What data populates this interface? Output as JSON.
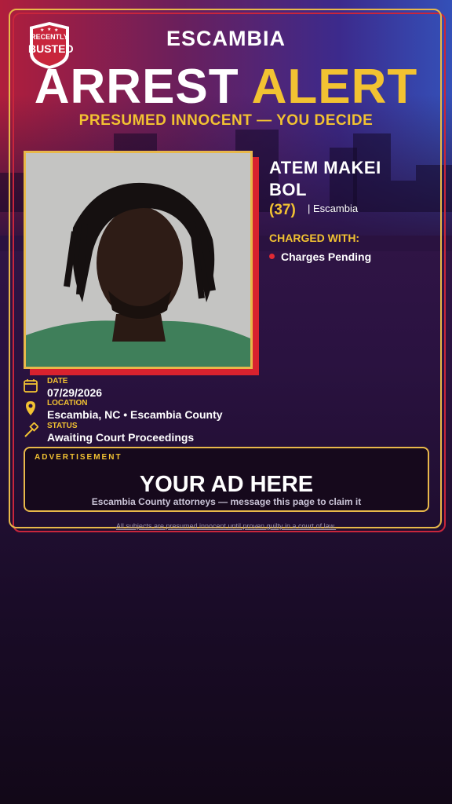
{
  "badge": {
    "line1": "RECENTLY",
    "line2": "BUSTED"
  },
  "header": {
    "county": "ESCAMBIA",
    "headline_word1": "ARREST",
    "headline_word2": "ALERT",
    "tagline": "PRESUMED INNOCENT — YOU DECIDE"
  },
  "subject": {
    "name_line1": "ATEM MAKEI",
    "name_line2": "BOL",
    "age": "(37)",
    "location_tag": "| Escambia",
    "charged_with_label": "CHARGED WITH:",
    "charges": [
      "Charges Pending"
    ]
  },
  "details": {
    "date_label": "DATE",
    "date_value": "07/29/2026",
    "location_label": "LOCATION",
    "location_value": "Escambia, NC • Escambia County",
    "status_label": "STATUS",
    "status_value": "Awaiting Court Proceedings"
  },
  "ad": {
    "label": "ADVERTISEMENT",
    "title": "YOUR AD HERE",
    "subtitle": "Escambia County attorneys — message this page to claim it"
  },
  "footer": {
    "disclaimer": "All subjects are presumed innocent until proven guilty in a court of law."
  },
  "colors": {
    "accent_gold": "#f2c232",
    "accent_red": "#d8222e",
    "frame_gold": "#e8b84a"
  },
  "icons": [
    "calendar-icon",
    "location-pin-icon",
    "gavel-icon"
  ]
}
